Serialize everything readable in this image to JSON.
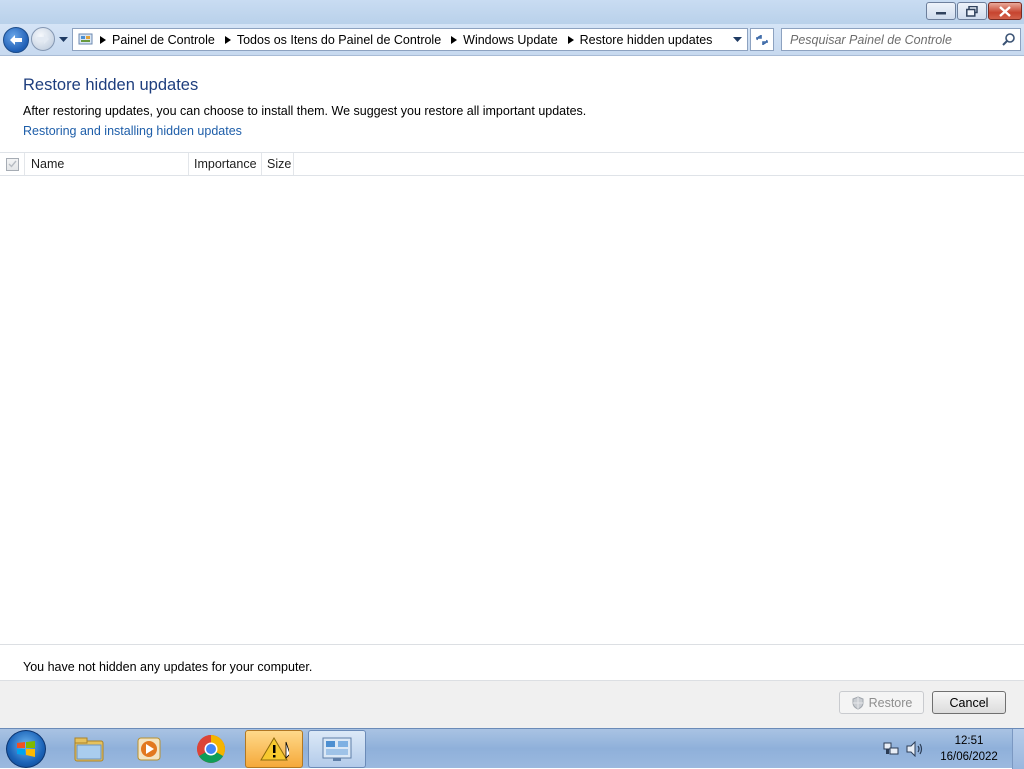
{
  "navigation": {
    "breadcrumbs": [
      "Painel de Controle",
      "Todos os Itens do Painel de Controle",
      "Windows Update",
      "Restore hidden updates"
    ],
    "search_placeholder": "Pesquisar Painel de Controle"
  },
  "main": {
    "title": "Restore hidden updates",
    "description": "After restoring updates, you can choose to install them. We suggest you restore all important updates.",
    "help_link": "Restoring and installing hidden updates",
    "columns": [
      "Name",
      "Importance",
      "Size"
    ],
    "rows": [],
    "status_text": "You have not hidden any updates for your computer."
  },
  "buttons": {
    "restore": "Restore",
    "cancel": "Cancel"
  },
  "taskbar": {
    "pinned": [
      "start-orb",
      "explorer-icon",
      "media-player-icon",
      "chrome-icon",
      "warning-app-icon",
      "control-panel-icon"
    ],
    "time": "12:51",
    "date": "16/06/2022"
  },
  "colors": {
    "heading": "#1e3e7e",
    "link": "#1e5ea9",
    "titlebar": "#c9dcf2"
  }
}
